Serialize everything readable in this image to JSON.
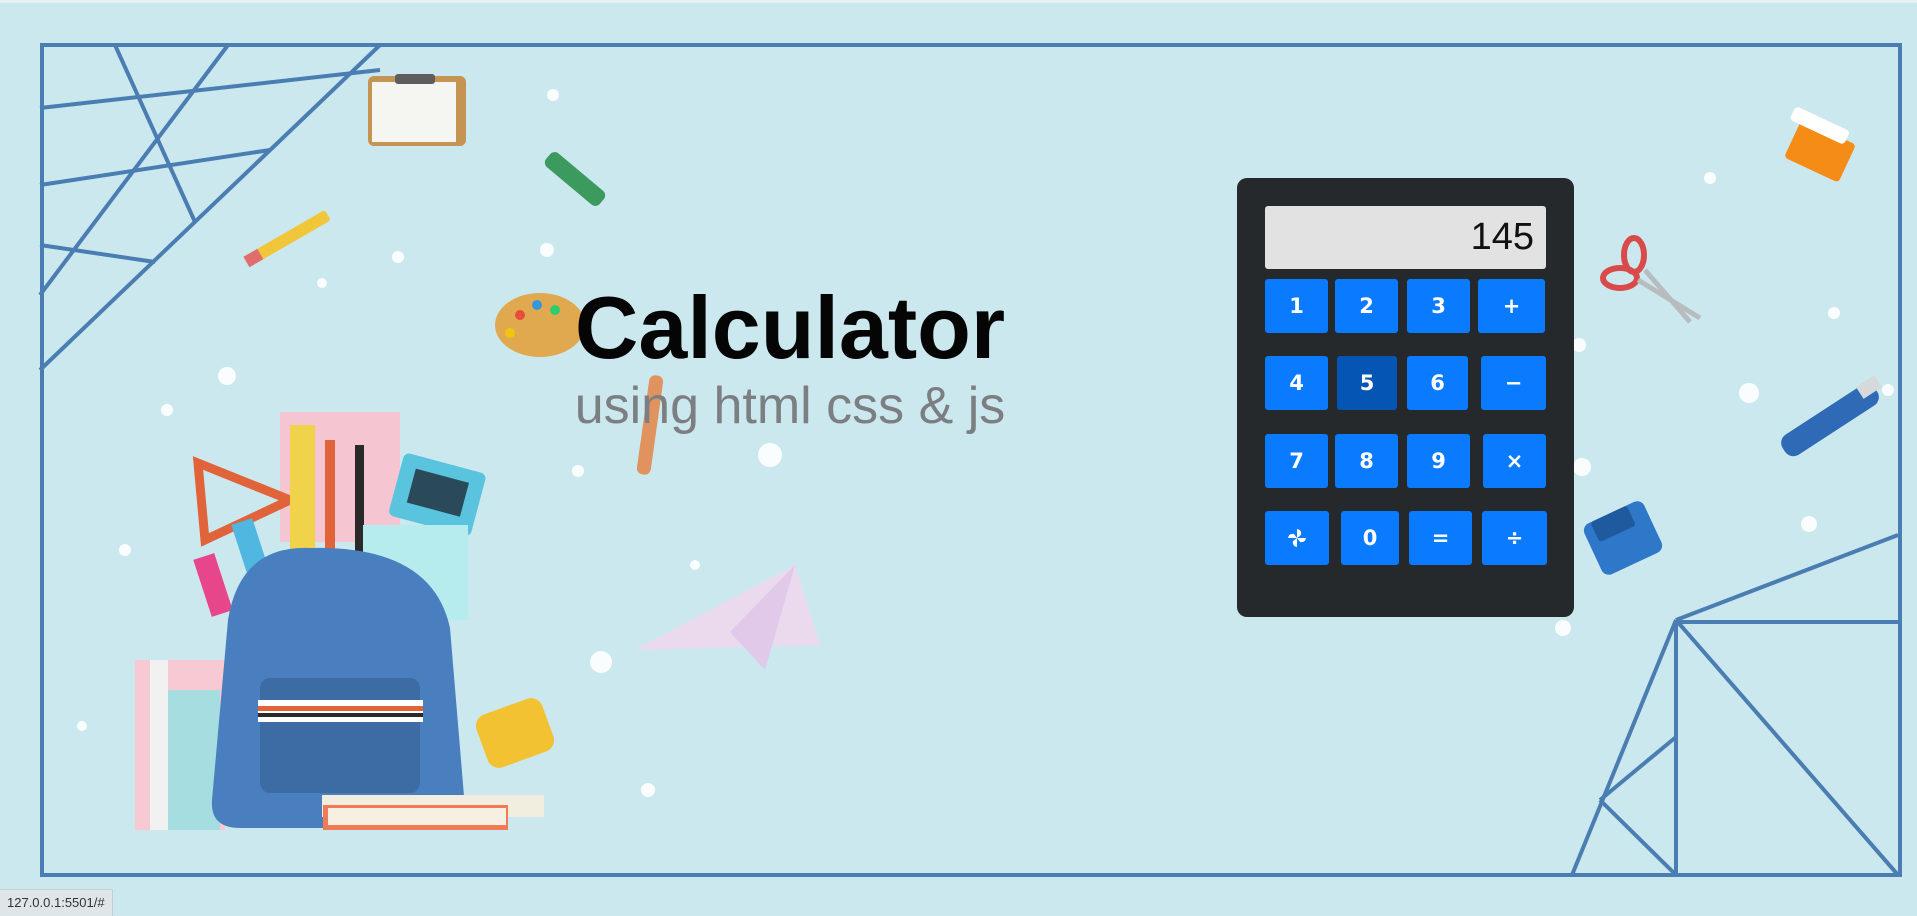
{
  "hero": {
    "title": "Calculator",
    "subtitle": "using html css & js"
  },
  "calculator": {
    "display_value": "145",
    "rows": [
      [
        {
          "label": "1",
          "name": "key-1"
        },
        {
          "label": "2",
          "name": "key-2"
        },
        {
          "label": "3",
          "name": "key-3"
        },
        {
          "label": "+",
          "name": "key-plus"
        }
      ],
      [
        {
          "label": "4",
          "name": "key-4"
        },
        {
          "label": "5",
          "name": "key-5",
          "active": true
        },
        {
          "label": "6",
          "name": "key-6"
        },
        {
          "label": "−",
          "name": "key-minus"
        }
      ],
      [
        {
          "label": "7",
          "name": "key-7"
        },
        {
          "label": "8",
          "name": "key-8"
        },
        {
          "label": "9",
          "name": "key-9"
        },
        {
          "label": "×",
          "name": "key-multiply"
        }
      ],
      [
        {
          "label": "pinwheel-icon",
          "name": "key-clear",
          "icon": true
        },
        {
          "label": "0",
          "name": "key-0"
        },
        {
          "label": "=",
          "name": "key-equals"
        },
        {
          "label": "÷",
          "name": "key-divide"
        }
      ]
    ],
    "colors": {
      "body": "#25292c",
      "key": "#0a7bff",
      "key_active": "#0455b4",
      "display_bg": "#e2e2e2"
    }
  },
  "status_bar": {
    "url": "127.0.0.1:5501/#"
  },
  "background": {
    "color": "#cce8ef",
    "frame_color": "#4a7db1"
  }
}
